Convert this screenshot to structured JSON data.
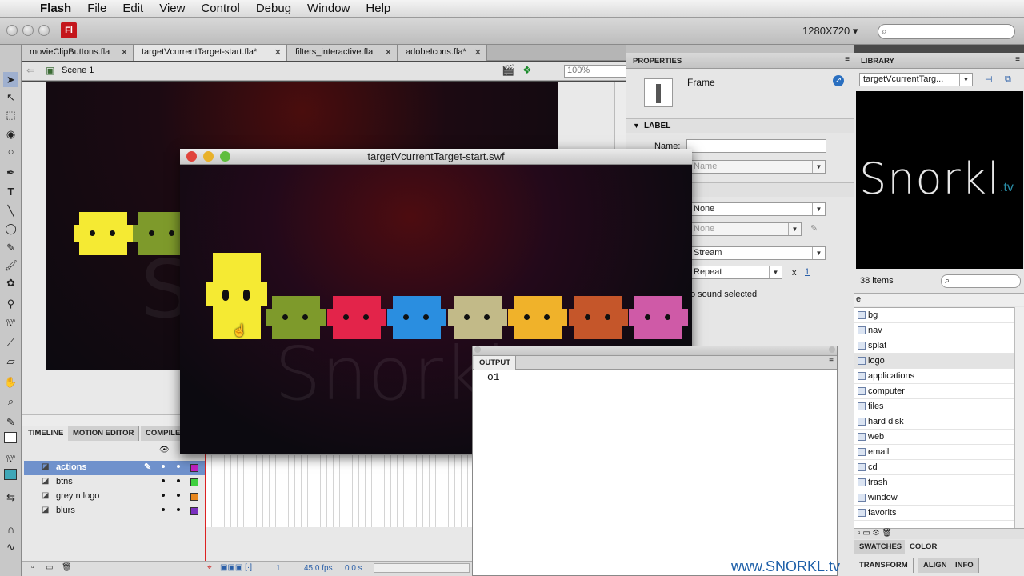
{
  "menubar": {
    "app_name": "Flash",
    "items": [
      "File",
      "Edit",
      "View",
      "Control",
      "Debug",
      "Window",
      "Help"
    ]
  },
  "appbar": {
    "logo_text": "Fl",
    "stage_size": "1280X720 ▾",
    "search_placeholder": ""
  },
  "doc_tabs": [
    {
      "label": "movieClipButtons.fla"
    },
    {
      "label": "targetVcurrentTarget-start.fla*"
    },
    {
      "label": "filters_interactive.fla"
    },
    {
      "label": "adobeIcons.fla*"
    }
  ],
  "scene": {
    "label": "Scene 1",
    "zoom": "100%"
  },
  "swf_window": {
    "title": "targetVcurrentTarget-start.swf",
    "watermark_text": "Snorkl"
  },
  "block_colors": {
    "yellow": "#f5ea33",
    "green": "#7e9a2b",
    "red": "#e3244a",
    "blue": "#2a8ee0",
    "khaki": "#c2ba88",
    "orange": "#f0b22a",
    "rust": "#c5562a",
    "pink": "#cf5aa7"
  },
  "timeline": {
    "tabs": [
      "TIMELINE",
      "MOTION EDITOR",
      "COMPILER ERRORS"
    ],
    "layers": [
      {
        "name": "actions",
        "color": "#c020c0"
      },
      {
        "name": "btns",
        "color": "#40d040"
      },
      {
        "name": "grey n logo",
        "color": "#e8871e"
      },
      {
        "name": "blurs",
        "color": "#7a30c0"
      }
    ],
    "status": {
      "frame": "1",
      "fps": "45.0 fps",
      "time": "0.0 s"
    }
  },
  "output": {
    "tab": "OUTPUT",
    "text": "o1"
  },
  "properties": {
    "title": "PROPERTIES",
    "type": "Frame",
    "label_section": "LABEL",
    "name_label": "Name:",
    "name_value": "",
    "label_type": "Name",
    "sound_name": "None",
    "effect": "None",
    "sync": "Stream",
    "repeat": "Repeat",
    "repeat_x": "x",
    "repeat_count": "1",
    "no_sound": "o sound selected"
  },
  "library": {
    "title": "LIBRARY",
    "document": "targetVcurrentTarg...",
    "preview_text": "Snorkl",
    "preview_tld": ".tv",
    "count": "38 items",
    "column_header": "e",
    "items": [
      "bg",
      "nav",
      "splat",
      "logo",
      "applications",
      "computer",
      "files",
      "hard disk",
      "web",
      "email",
      "cd",
      "trash",
      "window",
      "favorits"
    ]
  },
  "bottom_tabs": {
    "row1": [
      "SWATCHES",
      "COLOR"
    ],
    "row2": [
      "TRANSFORM",
      "ALIGN",
      "INFO"
    ]
  },
  "watermark": "www.SNORKL.tv"
}
